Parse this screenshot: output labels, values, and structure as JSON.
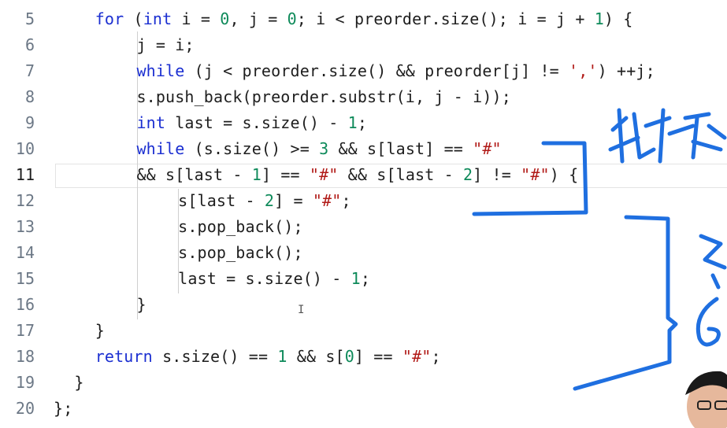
{
  "editor": {
    "lines": [
      {
        "num": "5",
        "tokens": [
          [
            "for",
            "kw"
          ],
          [
            " (",
            ""
          ],
          [
            "int",
            "kw"
          ],
          [
            " i = ",
            ""
          ],
          [
            "0",
            "num"
          ],
          [
            ", j = ",
            ""
          ],
          [
            "0",
            "num"
          ],
          [
            "; i < preorder.size(); i = j + ",
            ""
          ],
          [
            "1",
            "num"
          ],
          [
            ") {",
            ""
          ]
        ],
        "indent": 4
      },
      {
        "num": "6",
        "tokens": [
          [
            "j = i;",
            ""
          ]
        ],
        "indent": 8
      },
      {
        "num": "7",
        "tokens": [
          [
            "while",
            "kw"
          ],
          [
            " (j < preorder.size() && preorder[j] != ",
            ""
          ],
          [
            "','",
            "str"
          ],
          [
            ") ++j;",
            ""
          ]
        ],
        "indent": 8
      },
      {
        "num": "8",
        "tokens": [
          [
            "s.push_back(preorder.substr(i, j - i));",
            ""
          ]
        ],
        "indent": 8
      },
      {
        "num": "9",
        "tokens": [
          [
            "int",
            "kw"
          ],
          [
            " last = s.size() - ",
            ""
          ],
          [
            "1",
            "num"
          ],
          [
            ";",
            ""
          ]
        ],
        "indent": 8
      },
      {
        "num": "10",
        "tokens": [
          [
            "while",
            "kw"
          ],
          [
            " (s.size() >= ",
            ""
          ],
          [
            "3",
            "num"
          ],
          [
            " && s[last] == ",
            ""
          ],
          [
            "\"#\"",
            "str"
          ]
        ],
        "indent": 8
      },
      {
        "num": "11",
        "tokens": [
          [
            "&& s[last - ",
            ""
          ],
          [
            "1",
            "num"
          ],
          [
            "] == ",
            ""
          ],
          [
            "\"#\"",
            "str"
          ],
          [
            " && s[last - ",
            ""
          ],
          [
            "2",
            "num"
          ],
          [
            "] != ",
            ""
          ],
          [
            "\"#\"",
            "str"
          ],
          [
            ") {",
            ""
          ]
        ],
        "indent": 8,
        "active": true
      },
      {
        "num": "12",
        "tokens": [
          [
            "s[last - ",
            ""
          ],
          [
            "2",
            "num"
          ],
          [
            "] = ",
            ""
          ],
          [
            "\"#\"",
            "str"
          ],
          [
            ";",
            ""
          ]
        ],
        "indent": 12
      },
      {
        "num": "13",
        "tokens": [
          [
            "s.pop_back();",
            ""
          ]
        ],
        "indent": 12
      },
      {
        "num": "14",
        "tokens": [
          [
            "s.pop_back();",
            ""
          ]
        ],
        "indent": 12
      },
      {
        "num": "15",
        "tokens": [
          [
            "last = s.size() - ",
            ""
          ],
          [
            "1",
            "num"
          ],
          [
            ";",
            ""
          ]
        ],
        "indent": 12
      },
      {
        "num": "16",
        "tokens": [
          [
            "}",
            ""
          ]
        ],
        "indent": 8
      },
      {
        "num": "17",
        "tokens": [
          [
            "}",
            ""
          ]
        ],
        "indent": 4
      },
      {
        "num": "18",
        "tokens": [
          [
            "return",
            "kw"
          ],
          [
            " s.size() == ",
            ""
          ],
          [
            "1",
            "num"
          ],
          [
            " && s[",
            ""
          ],
          [
            "0",
            "num"
          ],
          [
            "] == ",
            ""
          ],
          [
            "\"#\"",
            "str"
          ],
          [
            ";",
            ""
          ]
        ],
        "indent": 4
      },
      {
        "num": "19",
        "tokens": [
          [
            "}",
            ""
          ]
        ],
        "indent": 2
      },
      {
        "num": "20",
        "tokens": [
          [
            "};",
            ""
          ]
        ],
        "indent": 0
      }
    ],
    "colors": {
      "keyword": "#1b2fd1",
      "number": "#0e8a5a",
      "string": "#b11a17",
      "ink": "#1f6fe0"
    }
  },
  "annotation": {
    "strokes_color": "#1f6fe0"
  }
}
